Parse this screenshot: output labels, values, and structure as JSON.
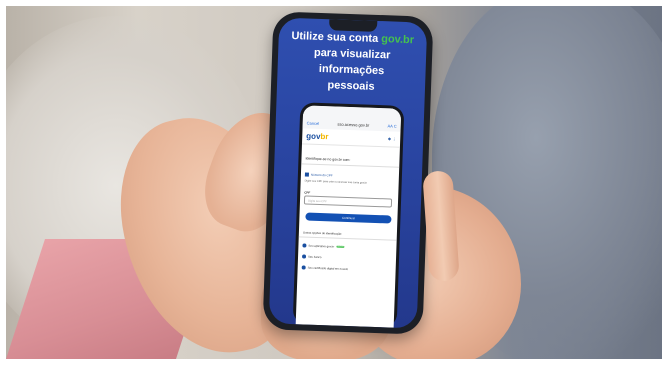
{
  "headline": {
    "line1_prefix": "Utilize sua conta ",
    "line1_brand": "gov.br",
    "line2": "para visualizar informações",
    "line3": "pessoais"
  },
  "browser": {
    "cancel": "Cancel",
    "url": "sso.acesso.gov.br",
    "controls": "AA C"
  },
  "brand": {
    "part1": "gov",
    "part2": "br"
  },
  "brand_icons": "✱ ⋮",
  "login": {
    "section_title": "Identifique-se no gov.br com:",
    "cpf_option": "Número do CPF",
    "hint": "Digite seu CPF para criar ou acessar sua conta gov.br",
    "field_label": "CPF",
    "field_placeholder": "Digite seu CPF",
    "continue": "Continuar",
    "other_options": "Outras opções de identificação:",
    "options": [
      {
        "label": "Seu aplicativo gov.br",
        "badge": "NOVO"
      },
      {
        "label": "Seu banco",
        "badge": ""
      },
      {
        "label": "Seu certificado digital em nuvem",
        "badge": ""
      }
    ]
  }
}
